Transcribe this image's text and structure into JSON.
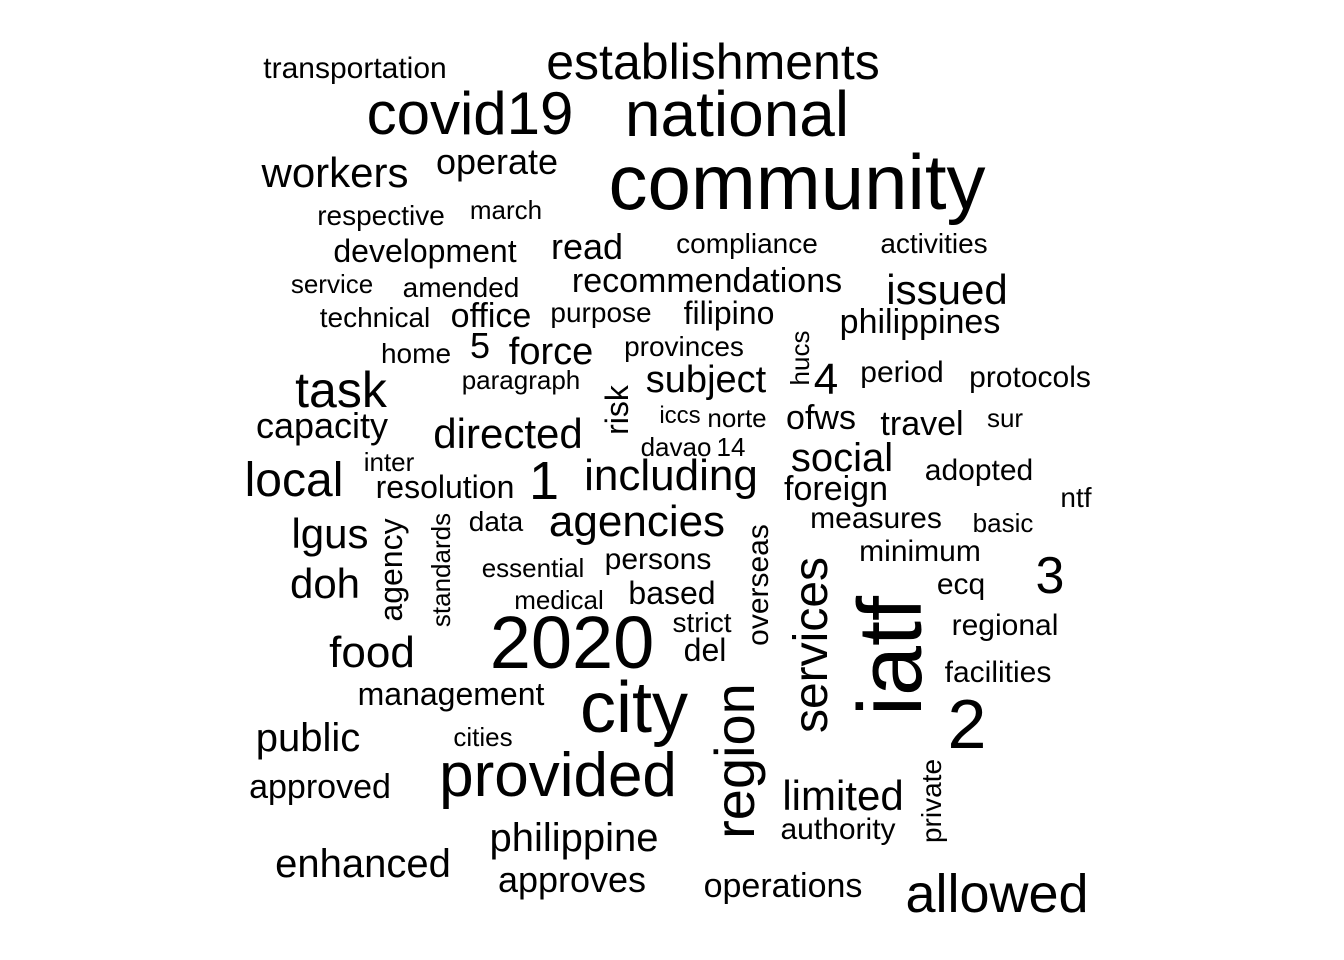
{
  "word_cloud": {
    "text_color": "#000000",
    "background": "#ffffff",
    "words": [
      {
        "text": "community",
        "vertical": false
      },
      {
        "text": "national",
        "vertical": false
      },
      {
        "text": "covid19",
        "vertical": false
      },
      {
        "text": "establishments",
        "vertical": false
      },
      {
        "text": "transportation",
        "vertical": false
      },
      {
        "text": "workers",
        "vertical": false
      },
      {
        "text": "operate",
        "vertical": false
      },
      {
        "text": "respective",
        "vertical": false
      },
      {
        "text": "march",
        "vertical": false
      },
      {
        "text": "development",
        "vertical": false
      },
      {
        "text": "read",
        "vertical": false
      },
      {
        "text": "compliance",
        "vertical": false
      },
      {
        "text": "activities",
        "vertical": false
      },
      {
        "text": "service",
        "vertical": false
      },
      {
        "text": "amended",
        "vertical": false
      },
      {
        "text": "recommendations",
        "vertical": false
      },
      {
        "text": "issued",
        "vertical": false
      },
      {
        "text": "technical",
        "vertical": false
      },
      {
        "text": "office",
        "vertical": false
      },
      {
        "text": "purpose",
        "vertical": false
      },
      {
        "text": "filipino",
        "vertical": false
      },
      {
        "text": "philippines",
        "vertical": false
      },
      {
        "text": "home",
        "vertical": false
      },
      {
        "text": "5",
        "vertical": false
      },
      {
        "text": "force",
        "vertical": false
      },
      {
        "text": "provinces",
        "vertical": false
      },
      {
        "text": "hucs",
        "vertical": true
      },
      {
        "text": "task",
        "vertical": false
      },
      {
        "text": "paragraph",
        "vertical": false
      },
      {
        "text": "risk",
        "vertical": true
      },
      {
        "text": "subject",
        "vertical": false
      },
      {
        "text": "4",
        "vertical": false
      },
      {
        "text": "period",
        "vertical": false
      },
      {
        "text": "protocols",
        "vertical": false
      },
      {
        "text": "capacity",
        "vertical": false
      },
      {
        "text": "directed",
        "vertical": false
      },
      {
        "text": "iccs",
        "vertical": false
      },
      {
        "text": "norte",
        "vertical": false
      },
      {
        "text": "ofws",
        "vertical": false
      },
      {
        "text": "travel",
        "vertical": false
      },
      {
        "text": "sur",
        "vertical": false
      },
      {
        "text": "davao",
        "vertical": false
      },
      {
        "text": "14",
        "vertical": false
      },
      {
        "text": "local",
        "vertical": false
      },
      {
        "text": "inter",
        "vertical": false
      },
      {
        "text": "1",
        "vertical": false
      },
      {
        "text": "including",
        "vertical": false
      },
      {
        "text": "social",
        "vertical": false
      },
      {
        "text": "adopted",
        "vertical": false
      },
      {
        "text": "resolution",
        "vertical": false
      },
      {
        "text": "foreign",
        "vertical": false
      },
      {
        "text": "ntf",
        "vertical": false
      },
      {
        "text": "lgus",
        "vertical": false
      },
      {
        "text": "agency",
        "vertical": true
      },
      {
        "text": "standards",
        "vertical": true
      },
      {
        "text": "data",
        "vertical": false
      },
      {
        "text": "agencies",
        "vertical": false
      },
      {
        "text": "overseas",
        "vertical": true
      },
      {
        "text": "measures",
        "vertical": false
      },
      {
        "text": "basic",
        "vertical": false
      },
      {
        "text": "doh",
        "vertical": false
      },
      {
        "text": "essential",
        "vertical": false
      },
      {
        "text": "persons",
        "vertical": false
      },
      {
        "text": "services",
        "vertical": true
      },
      {
        "text": "minimum",
        "vertical": false
      },
      {
        "text": "3",
        "vertical": false
      },
      {
        "text": "medical",
        "vertical": false
      },
      {
        "text": "based",
        "vertical": false
      },
      {
        "text": "iatf",
        "vertical": true
      },
      {
        "text": "ecq",
        "vertical": false
      },
      {
        "text": "2020",
        "vertical": false
      },
      {
        "text": "strict",
        "vertical": false
      },
      {
        "text": "regional",
        "vertical": false
      },
      {
        "text": "food",
        "vertical": false
      },
      {
        "text": "del",
        "vertical": false
      },
      {
        "text": "facilities",
        "vertical": false
      },
      {
        "text": "management",
        "vertical": false
      },
      {
        "text": "city",
        "vertical": false
      },
      {
        "text": "region",
        "vertical": true
      },
      {
        "text": "2",
        "vertical": false
      },
      {
        "text": "public",
        "vertical": false
      },
      {
        "text": "cities",
        "vertical": false
      },
      {
        "text": "approved",
        "vertical": false
      },
      {
        "text": "provided",
        "vertical": false
      },
      {
        "text": "limited",
        "vertical": false
      },
      {
        "text": "private",
        "vertical": true
      },
      {
        "text": "authority",
        "vertical": false
      },
      {
        "text": "philippine",
        "vertical": false
      },
      {
        "text": "enhanced",
        "vertical": false
      },
      {
        "text": "approves",
        "vertical": false
      },
      {
        "text": "operations",
        "vertical": false
      },
      {
        "text": "allowed",
        "vertical": false
      }
    ]
  }
}
